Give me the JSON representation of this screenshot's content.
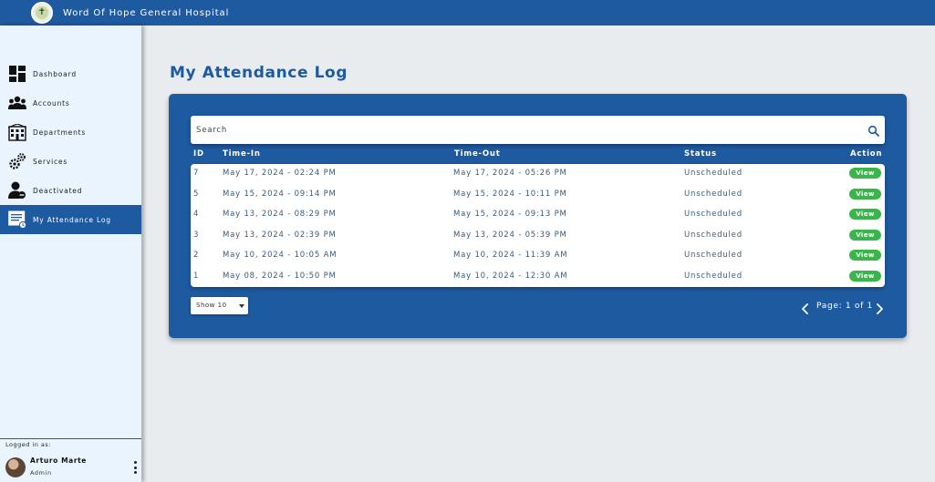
{
  "header": {
    "hospital_name": "Word Of Hope General Hospital",
    "logo_icon": "hospital-cross-logo"
  },
  "sidebar": {
    "items": [
      {
        "label": "Dashboard",
        "icon": "dashboard-icon",
        "active": false
      },
      {
        "label": "Accounts",
        "icon": "users-icon",
        "active": false
      },
      {
        "label": "Departments",
        "icon": "building-icon",
        "active": false
      },
      {
        "label": "Services",
        "icon": "gears-icon",
        "active": false
      },
      {
        "label": "Deactivated",
        "icon": "user-deactivated-icon",
        "active": false
      },
      {
        "label": "My Attendance Log",
        "icon": "attendance-log-icon",
        "active": true
      }
    ],
    "logged_in_label": "Logged in as:",
    "user": {
      "name": "Arturo Marte",
      "role": "Admin"
    }
  },
  "main": {
    "title": "My Attendance Log",
    "search": {
      "placeholder": "Search",
      "value": ""
    },
    "columns": {
      "id": "ID",
      "time_in": "Time-In",
      "time_out": "Time-Out",
      "status": "Status",
      "action": "Action"
    },
    "rows": [
      {
        "id": "7",
        "time_in": "May 17, 2024 - 02:24 PM",
        "time_out": "May 17, 2024 - 05:26 PM",
        "status": "Unscheduled",
        "action": "View"
      },
      {
        "id": "5",
        "time_in": "May 15, 2024 - 09:14 PM",
        "time_out": "May 15, 2024 - 10:11 PM",
        "status": "Unscheduled",
        "action": "View"
      },
      {
        "id": "4",
        "time_in": "May 13, 2024 - 08:29 PM",
        "time_out": "May 15, 2024 - 09:13 PM",
        "status": "Unscheduled",
        "action": "View"
      },
      {
        "id": "3",
        "time_in": "May 13, 2024 - 02:39 PM",
        "time_out": "May 13, 2024 - 05:39 PM",
        "status": "Unscheduled",
        "action": "View"
      },
      {
        "id": "2",
        "time_in": "May 10, 2024 - 10:05 AM",
        "time_out": "May 10, 2024 - 11:39 AM",
        "status": "Unscheduled",
        "action": "View"
      },
      {
        "id": "1",
        "time_in": "May 08, 2024 - 10:50 PM",
        "time_out": "May 10, 2024 - 12:30 AM",
        "status": "Unscheduled",
        "action": "View"
      }
    ],
    "page_size": {
      "selected": "Show 10"
    },
    "pagination": {
      "text": "Page: 1 of 1"
    }
  },
  "colors": {
    "primary": "#1e5aa0",
    "sidebar_bg": "#eaf4ff",
    "page_bg": "#e9ecef",
    "view_button": "#39b54a",
    "cell_text": "#3a5b78"
  }
}
